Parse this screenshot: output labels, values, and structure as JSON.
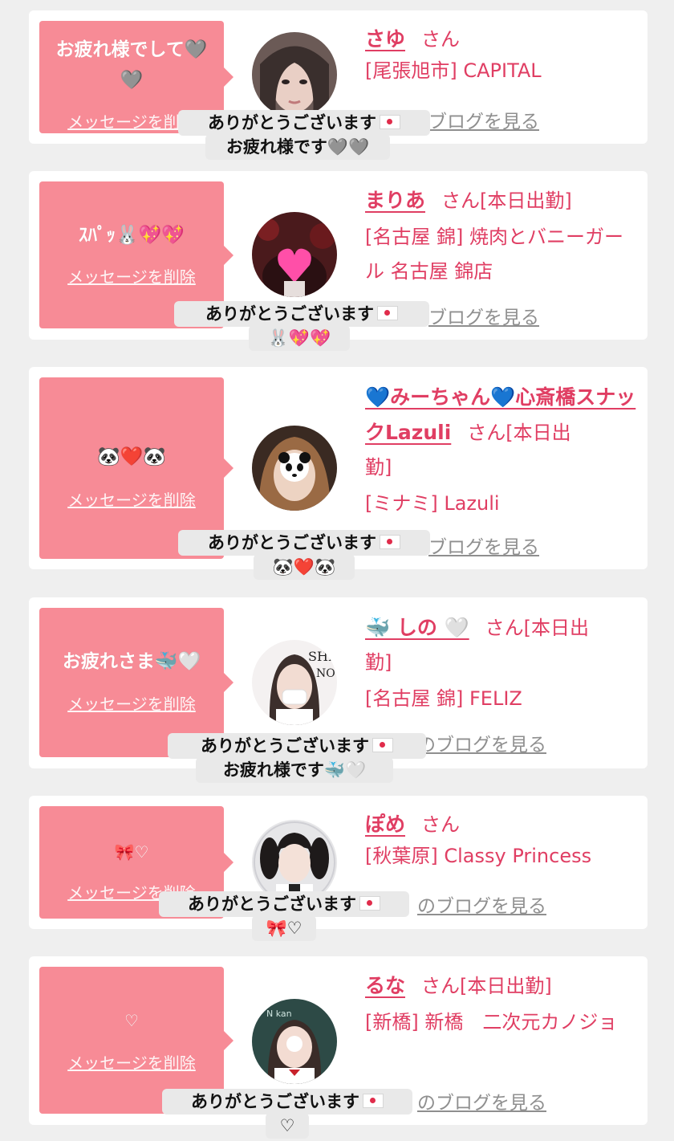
{
  "delete_label": "メッセージを削除",
  "san_label": "さん",
  "cards": [
    {
      "message_lines": [
        "お疲れ様でして🩶",
        "🩶"
      ],
      "name": "さゆ",
      "shift": "",
      "shift_line2": "",
      "shop": "[尾張旭市] CAPITAL",
      "blog_label": "ブログを見る",
      "reply_lines": [
        "ありがとうございます",
        "お疲れ様です🩶🩶"
      ]
    },
    {
      "message_lines": [
        "ｽﾊﾟｯ🐰💖💖"
      ],
      "name": "まりあ",
      "shift": "[本日出勤]",
      "shift_line2": "",
      "shop": "[名古屋 錦] 焼肉とバニーガール 名古屋 錦店",
      "blog_label": "ブログを見る",
      "reply_lines": [
        "ありがとうございます",
        "🐰💖💖"
      ]
    },
    {
      "message_lines": [
        "🐼❤️🐼"
      ],
      "name": "💙みーちゃん💙心斎橋スナックLazuli",
      "shift": "[本日出",
      "shift_line2": "勤]",
      "shop": "[ミナミ] Lazuli",
      "blog_label": "ブログを見る",
      "reply_lines": [
        "ありがとうございます",
        "🐼❤️🐼"
      ]
    },
    {
      "message_lines": [
        "お疲れさま🐳🤍"
      ],
      "name": "🐳 しの 🤍",
      "shift": "[本日出",
      "shift_line2": "勤]",
      "shop": "[名古屋 錦] FELIZ",
      "blog_label": "のブログを見る",
      "reply_lines": [
        "ありがとうございます",
        "お疲れ様です🐳🤍"
      ]
    },
    {
      "message_lines": [
        "🎀♡"
      ],
      "name": "ぽめ",
      "shift": "",
      "shift_line2": "",
      "shop": "[秋葉原] Classy Princess",
      "blog_label": "のブログを見る",
      "reply_lines": [
        "ありがとうございます",
        "🎀♡"
      ]
    },
    {
      "message_lines": [
        "♡"
      ],
      "name": "るな",
      "shift": "[本日出勤]",
      "shift_line2": "",
      "shop": "[新橋] 新橋　二次元カノジョ",
      "blog_label": "のブログを見る",
      "reply_lines": [
        "ありがとうございます",
        "♡"
      ]
    }
  ],
  "colors": {
    "page_bg": "#efefef",
    "bubble": "#f78b96",
    "accent": "#e03e63",
    "blog_link": "#8f8f8f",
    "reply_bg": "#e9e9e9"
  }
}
